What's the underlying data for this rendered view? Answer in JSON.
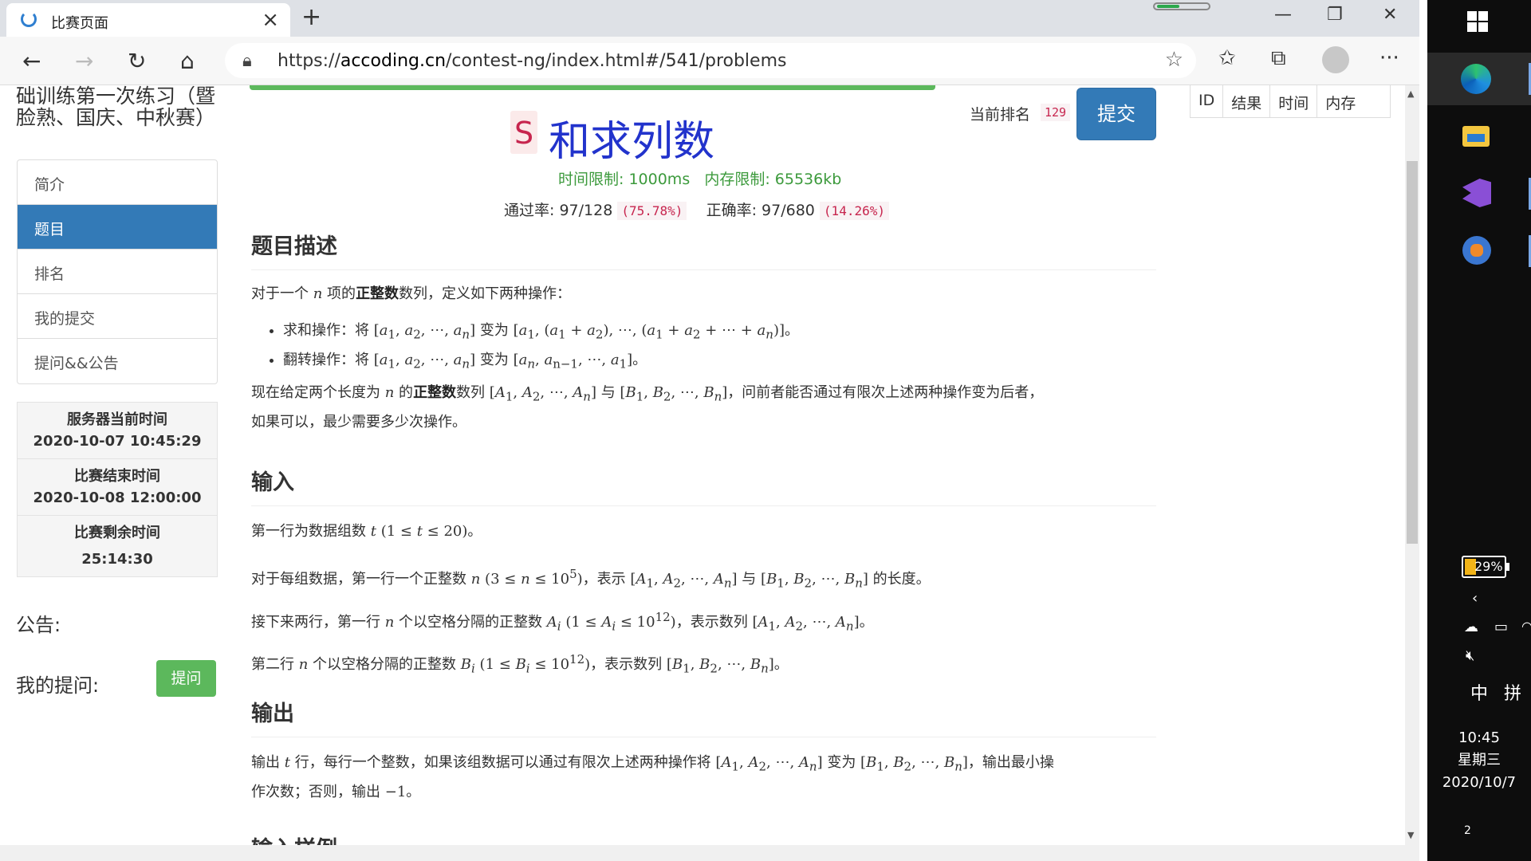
{
  "browser": {
    "tab_title": "比赛页面",
    "url_prefix": "https://",
    "url_domain": "accoding.cn",
    "url_path": "/contest-ng/index.html#/541/problems"
  },
  "sidebar": {
    "contest_title": "础训练第一次练习（暨脸熟、国庆、中秋赛）",
    "menu": [
      {
        "label": "简介",
        "active": false
      },
      {
        "label": "题目",
        "active": true
      },
      {
        "label": "排名",
        "active": false
      },
      {
        "label": "我的提交",
        "active": false
      },
      {
        "label": "提问&&公告",
        "active": false
      }
    ],
    "server_time_label": "服务器当前时间",
    "server_time": "2020-10-07 10:45:29",
    "end_time_label": "比赛结束时间",
    "end_time": "2020-10-08 12:00:00",
    "remaining_label": "比赛剩余时间",
    "remaining": "25:14:30",
    "notice_label": "公告:",
    "my_questions_label": "我的提问:",
    "ask_button": "提问"
  },
  "problem": {
    "letter": "S",
    "name": "和求列数",
    "time_limit_label": "时间限制:",
    "time_limit": "1000ms",
    "memory_limit_label": "内存限制:",
    "memory_limit": "65536kb",
    "pass_label": "通过率:",
    "pass": "97/128",
    "pass_pct": "(75.78%)",
    "correct_label": "正确率:",
    "correct": "97/680",
    "correct_pct": "(14.26%)",
    "rank_label": "当前排名",
    "rank": "129",
    "submit_button": "提交",
    "description_heading": "题目描述",
    "input_heading": "输入",
    "output_heading": "输出",
    "sample_heading": "输入样例"
  },
  "result_table": {
    "columns": [
      "ID",
      "结果",
      "时间",
      "内存"
    ]
  },
  "taskbar": {
    "battery": "29%",
    "ime_lang": "中",
    "ime_mode": "拼",
    "time": "10:45",
    "weekday": "星期三",
    "date": "2020/10/7",
    "notifications": "2"
  }
}
